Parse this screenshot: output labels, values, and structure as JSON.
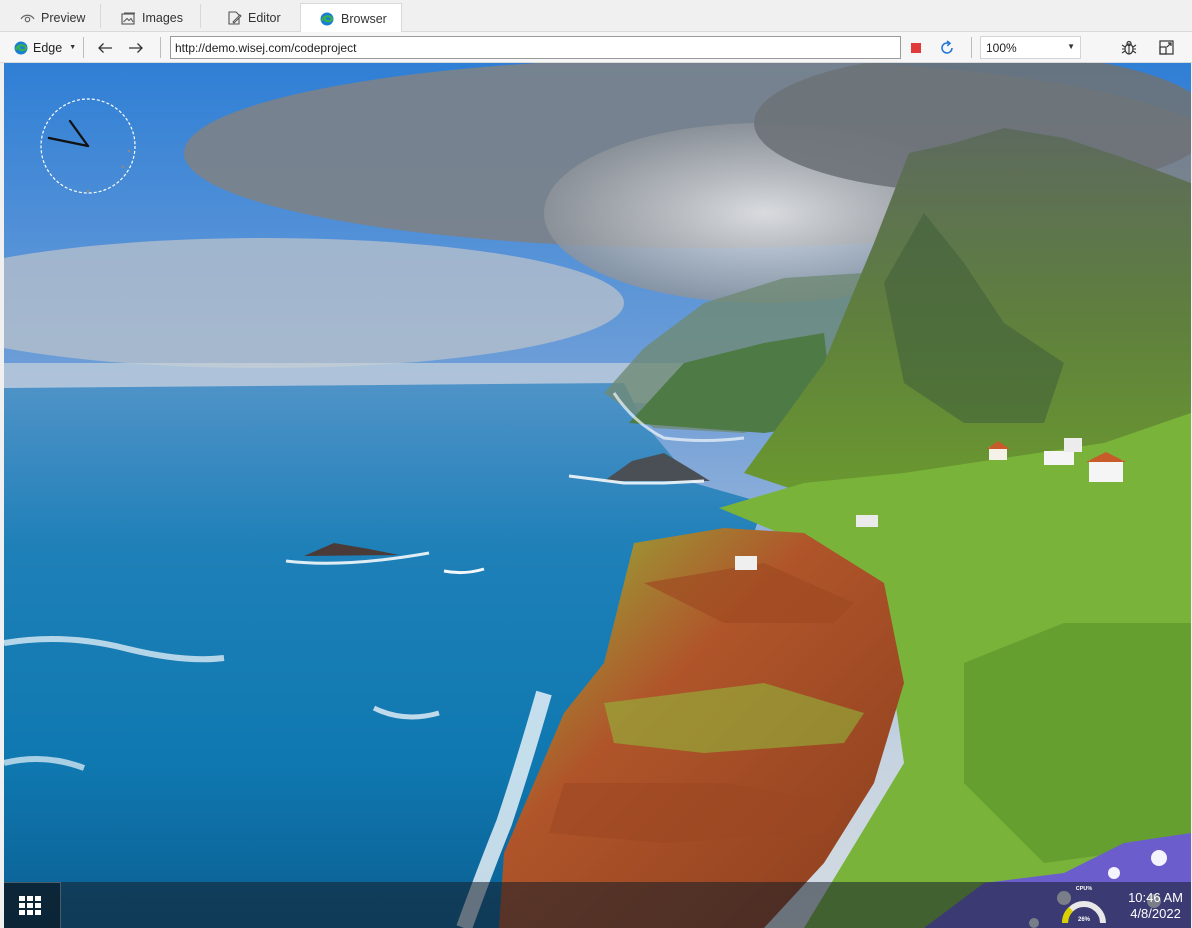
{
  "tabs": [
    {
      "label": "Preview",
      "icon": "eye-icon"
    },
    {
      "label": "Images",
      "icon": "images-icon"
    },
    {
      "label": "Editor",
      "icon": "editor-icon"
    },
    {
      "label": "Browser",
      "icon": "edge-icon",
      "active": true
    }
  ],
  "toolbar": {
    "browser_select": "Edge",
    "url": "http://demo.wisej.com/codeproject",
    "zoom": "100%"
  },
  "desktop": {
    "taskbar": {
      "time": "10:46 AM",
      "date": "4/8/2022",
      "cpu_label": "CPU%",
      "cpu_value": "26%",
      "cpu_fraction": 0.26
    }
  },
  "colors": {
    "stop": "#e03a3a",
    "refresh": "#1a73d9",
    "edge_blue": "#1b7fd1",
    "edge_green": "#38b34a"
  }
}
